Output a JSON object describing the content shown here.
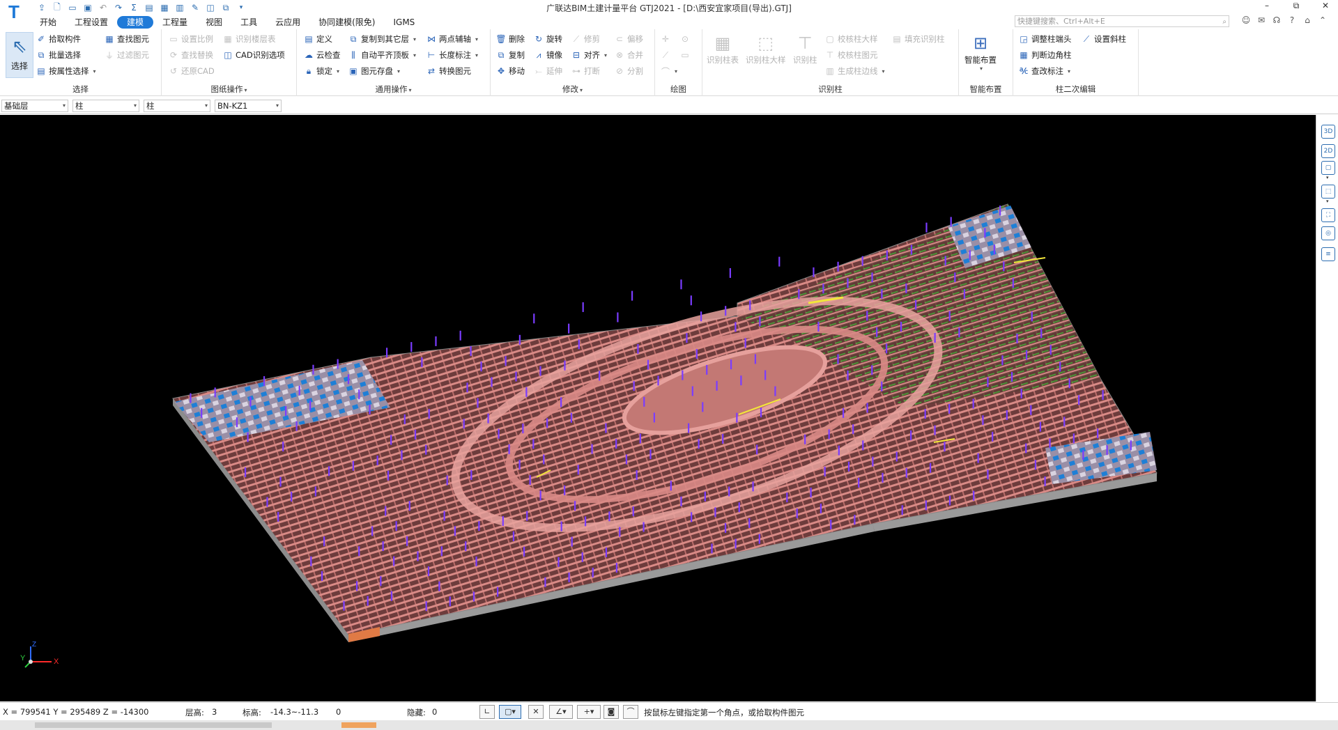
{
  "app": {
    "title": "广联达BIM土建计量平台 GTJ2021 - [D:\\西安宜家项目(导出).GTJ]",
    "logo_letter": "T",
    "window_controls": [
      "–",
      "⧉",
      "✕"
    ]
  },
  "menu": {
    "tabs": [
      "开始",
      "工程设置",
      "建模",
      "工程量",
      "视图",
      "工具",
      "云应用",
      "协同建模(限免)",
      "IGMS"
    ],
    "active": "建模"
  },
  "search": {
    "placeholder": "快捷键搜索、Ctrl+Alt+E"
  },
  "ribbon": {
    "select_group": {
      "label": "选择",
      "big_button": "选择",
      "items": [
        "拾取构件",
        "批量选择",
        "按属性选择",
        "查找图元",
        "过滤图元"
      ]
    },
    "drawing_ops": {
      "label": "图纸操作",
      "items": [
        "设置比例",
        "查找替换",
        "还原CAD",
        "识别楼层表",
        "CAD识别选项"
      ]
    },
    "common_ops": {
      "label": "通用操作",
      "items": [
        "定义",
        "云检查",
        "锁定",
        "复制到其它层",
        "自动平齐顶板",
        "图元存盘",
        "两点辅轴",
        "长度标注",
        "转换图元"
      ]
    },
    "modify": {
      "label": "修改",
      "items": [
        "删除",
        "复制",
        "移动",
        "旋转",
        "镜像",
        "延伸",
        "修剪",
        "对齐",
        "打断",
        "偏移",
        "合并",
        "分割"
      ]
    },
    "draw": {
      "label": "绘图"
    },
    "recognize_column": {
      "label": "识别柱",
      "big_items": [
        "识别柱表",
        "识别柱大样",
        "识别柱"
      ],
      "items": [
        "校核柱大样",
        "校核柱图元",
        "生成柱边线",
        "填充识别柱"
      ]
    },
    "smart_layout": {
      "label": "智能布置",
      "big_button": "智能布置"
    },
    "column_edit": {
      "label": "柱二次编辑",
      "items": [
        "调整柱端头",
        "判断边角柱",
        "查改标注",
        "设置斜柱"
      ]
    }
  },
  "selectors": {
    "floor": "基础层",
    "category": "柱",
    "type": "柱",
    "component": "BN-KZ1"
  },
  "viewport": {
    "axis_labels": {
      "x": "X",
      "y": "Y",
      "z": "Z"
    },
    "colors": {
      "background": "#000000",
      "slab": "#b96d6a",
      "beam": "#d98a86",
      "column": "#7a3cff",
      "wall": "#9a9a9a",
      "green_beam": "#3fae34",
      "blue_zone": "#1e7fd6",
      "yellow_beam": "#f2e63a"
    }
  },
  "view_toolbar": [
    "3D",
    "2D",
    "▢",
    "⬚",
    "⛶",
    "◎",
    "≡"
  ],
  "statusbar": {
    "coords": "X = 799541 Y = 295489 Z = -14300",
    "floor_height_label": "层高:",
    "floor_height": "3",
    "elevation_label": "标高:",
    "elevation": "-14.3~-11.3",
    "count": "0",
    "hidden_label": "隐藏:",
    "hidden": "0",
    "hint": "按鼠标左键指定第一个角点，或拾取构件图元"
  }
}
